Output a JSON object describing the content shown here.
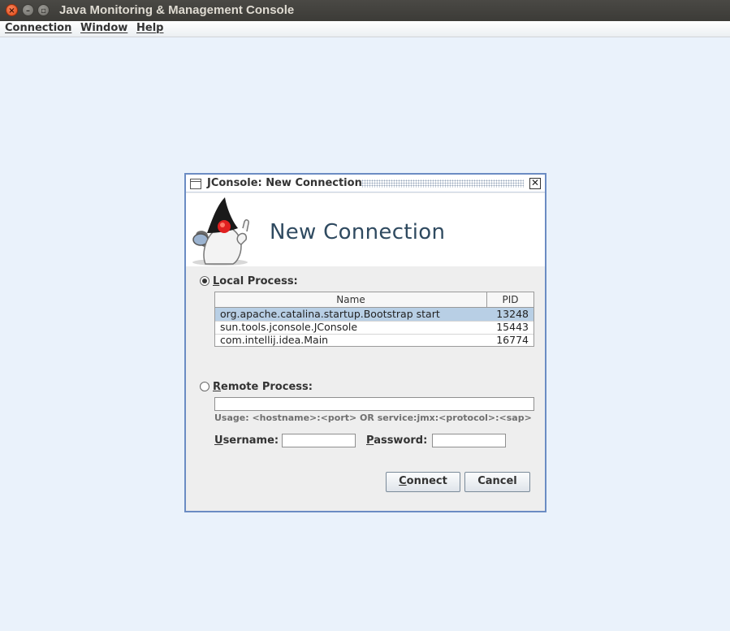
{
  "window": {
    "title": "Java Monitoring & Management Console",
    "close_glyph": "×",
    "min_glyph": "–",
    "max_glyph": "▫"
  },
  "menubar": {
    "items": [
      {
        "label": "Connection",
        "mnemonic": "C",
        "rest": "onnection"
      },
      {
        "label": "Window",
        "mnemonic": "W",
        "rest": "indow"
      },
      {
        "label": "Help",
        "mnemonic": "H",
        "rest": "elp"
      }
    ]
  },
  "dialog": {
    "title": "JConsole: New Connection",
    "close_glyph": "✕",
    "header_title": "New Connection",
    "local": {
      "label_mnemonic": "L",
      "label_rest": "ocal Process:",
      "selected": true,
      "columns": [
        "Name",
        "PID"
      ],
      "rows": [
        {
          "name": "org.apache.catalina.startup.Bootstrap start",
          "pid": "13248",
          "selected": true
        },
        {
          "name": "sun.tools.jconsole.JConsole",
          "pid": "15443",
          "selected": false
        },
        {
          "name": "com.intellij.idea.Main",
          "pid": "16774",
          "selected": false
        }
      ]
    },
    "remote": {
      "label_mnemonic": "R",
      "label_rest": "emote Process:",
      "selected": false,
      "value": "",
      "usage": "Usage: <hostname>:<port> OR service:jmx:<protocol>:<sap>",
      "username_mnemonic": "U",
      "username_rest": "sername:",
      "username_value": "",
      "password_mnemonic": "P",
      "password_rest": "assword:",
      "password_value": ""
    },
    "buttons": {
      "connect_mnemonic": "C",
      "connect_rest": "onnect",
      "cancel": "Cancel"
    }
  },
  "icons": {
    "frame": "internal-frame-icon",
    "mascot": "duke-mascot-icon"
  },
  "colors": {
    "desktop": "#eaf2fb",
    "dialog_border": "#6b8cc3",
    "selection": "#b8cfe5",
    "header_text": "#2f4a60"
  }
}
